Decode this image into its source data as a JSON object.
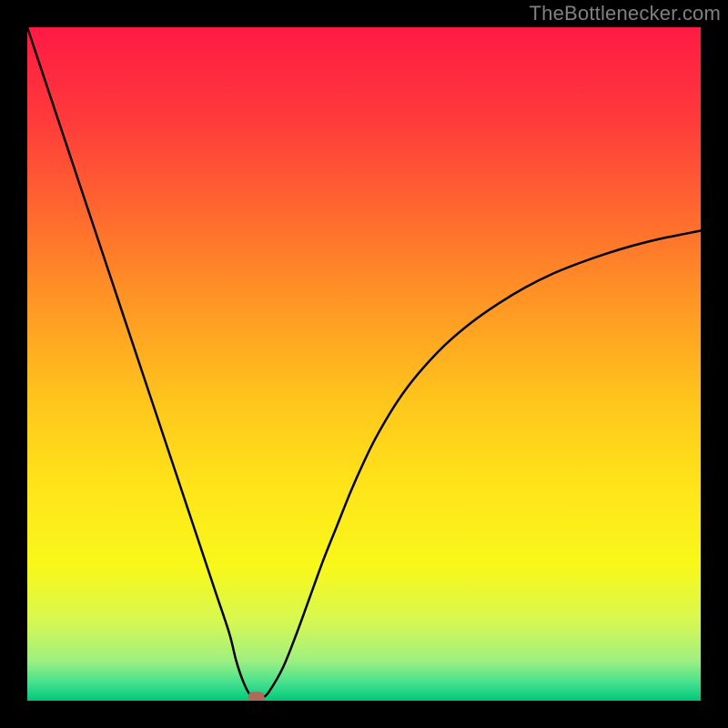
{
  "watermark": "TheBottlenecker.com",
  "chart_data": {
    "type": "line",
    "title": "",
    "xlabel": "",
    "ylabel": "",
    "xlim": [
      0,
      100
    ],
    "ylim": [
      0,
      100
    ],
    "x": [
      0,
      2,
      4,
      6,
      8,
      10,
      12,
      14,
      16,
      18,
      20,
      22,
      24,
      26,
      28,
      30,
      31,
      32,
      33,
      34,
      35,
      36,
      38,
      40,
      42,
      44,
      46,
      48,
      50,
      52,
      55,
      58,
      62,
      66,
      70,
      74,
      78,
      82,
      86,
      90,
      94,
      98,
      100
    ],
    "values": [
      100,
      94,
      88,
      82,
      76,
      70,
      64,
      58,
      52,
      46,
      40,
      34,
      28,
      22,
      16,
      10,
      6,
      3,
      1,
      0.5,
      0.5,
      1.5,
      5,
      10,
      15.5,
      21,
      26,
      31,
      35.5,
      39.5,
      44.5,
      48.5,
      52.8,
      56.2,
      59,
      61.4,
      63.4,
      65,
      66.4,
      67.6,
      68.6,
      69.4,
      69.8
    ],
    "minimum_x": 34,
    "marker": {
      "x": 34,
      "y": 0.5,
      "color": "#b06a5a"
    },
    "background_gradient": {
      "type": "vertical",
      "stops": [
        {
          "offset": 0.0,
          "color": "#ff1a44"
        },
        {
          "offset": 0.14,
          "color": "#ff3b3b"
        },
        {
          "offset": 0.28,
          "color": "#ff6a2e"
        },
        {
          "offset": 0.42,
          "color": "#ff9a24"
        },
        {
          "offset": 0.56,
          "color": "#ffc71c"
        },
        {
          "offset": 0.68,
          "color": "#ffe41a"
        },
        {
          "offset": 0.8,
          "color": "#f8f81a"
        },
        {
          "offset": 0.88,
          "color": "#d8f850"
        },
        {
          "offset": 0.94,
          "color": "#a0f080"
        },
        {
          "offset": 0.975,
          "color": "#40e090"
        },
        {
          "offset": 1.0,
          "color": "#00c878"
        }
      ]
    }
  }
}
